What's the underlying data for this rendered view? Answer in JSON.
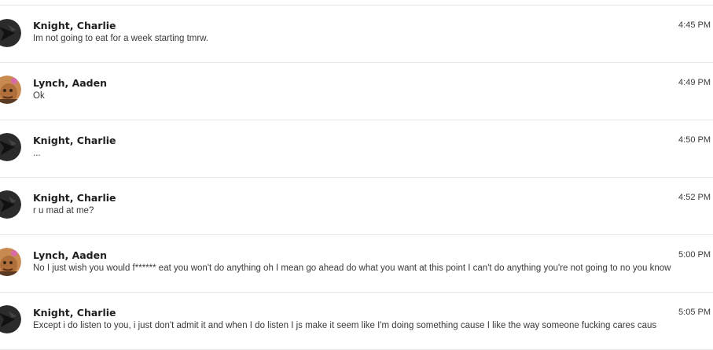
{
  "messages": [
    {
      "sender": "Knight, Charlie",
      "text": "Im not going to eat for a week starting tmrw.",
      "time": "4:45 PM",
      "avatar": "dark-avatar"
    },
    {
      "sender": "Lynch, Aaden",
      "text": "Ok",
      "time": "4:49 PM",
      "avatar": "photo-avatar"
    },
    {
      "sender": "Knight, Charlie",
      "text": "...",
      "time": "4:50 PM",
      "avatar": "dark-avatar"
    },
    {
      "sender": "Knight, Charlie",
      "text": "r u mad at me?",
      "time": "4:52 PM",
      "avatar": "dark-avatar"
    },
    {
      "sender": "Lynch, Aaden",
      "text": "No I just wish you would f****** eat you won't do anything oh I mean go ahead do what you want at this point I can't do anything you're not going to no you know",
      "time": "5:00 PM",
      "avatar": "photo-avatar"
    },
    {
      "sender": "Knight, Charlie",
      "text": "Except i do listen to you, i just don't admit it and when I do listen I js make it seem like I'm doing something cause I like the way someone fucking cares caus",
      "time": "5:05 PM",
      "avatar": "dark-avatar"
    }
  ],
  "colors": {
    "divider": "#e6e6e6",
    "name": "#1f1f1f",
    "body_text": "#3a3a3a",
    "dark_avatar": "#2b2b2b"
  }
}
